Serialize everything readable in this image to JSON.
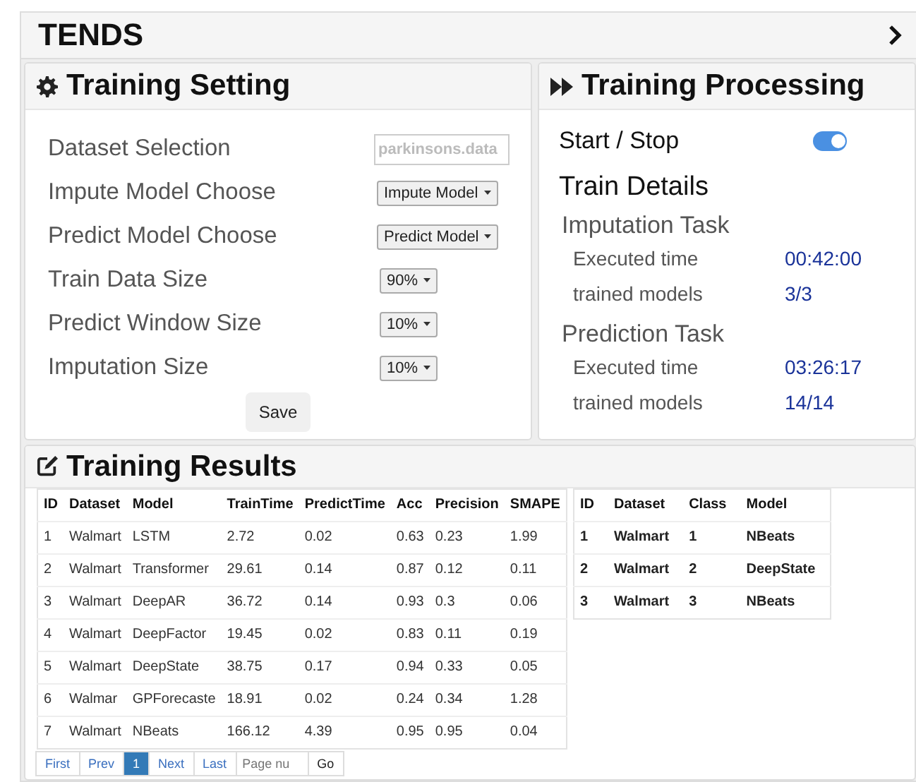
{
  "app": {
    "title": "TENDS"
  },
  "training_setting": {
    "title": "Training Setting",
    "fields": [
      {
        "label": "Dataset Selection",
        "kind": "input",
        "placeholder": "parkinsons.data"
      },
      {
        "label": "Impute Model Choose",
        "kind": "dropdown",
        "value": "Impute Model"
      },
      {
        "label": "Predict Model Choose",
        "kind": "dropdown",
        "value": "Predict Model"
      },
      {
        "label": "Train Data Size",
        "kind": "dropdown",
        "value": "90%"
      },
      {
        "label": "Predict Window Size",
        "kind": "dropdown",
        "value": "10%"
      },
      {
        "label": "Imputation Size",
        "kind": "dropdown",
        "value": "10%"
      }
    ],
    "save": "Save"
  },
  "training_processing": {
    "title": "Training Processing",
    "start_stop": {
      "label": "Start / Stop",
      "on": true
    },
    "details_title": "Train Details",
    "tasks": [
      {
        "title": "Imputation Task",
        "rows": [
          {
            "label": "Executed time",
            "value": "00:42:00"
          },
          {
            "label": "trained models",
            "value": "3/3"
          }
        ]
      },
      {
        "title": "Prediction Task",
        "rows": [
          {
            "label": "Executed time",
            "value": "03:26:17"
          },
          {
            "label": "trained models",
            "value": "14/14"
          }
        ]
      }
    ]
  },
  "training_results": {
    "title": "Training Results",
    "table": {
      "columns": [
        "ID",
        "Dataset",
        "Model",
        "TrainTime",
        "PredictTime",
        "Acc",
        "Precision",
        "SMAPE"
      ],
      "rows": [
        [
          "1",
          "Walmart",
          "LSTM",
          "2.72",
          "0.02",
          "0.63",
          "0.23",
          "1.99"
        ],
        [
          "2",
          "Walmart",
          "Transformer",
          "29.61",
          "0.14",
          "0.87",
          "0.12",
          "0.11"
        ],
        [
          "3",
          "Walmart",
          "DeepAR",
          "36.72",
          "0.14",
          "0.93",
          "0.3",
          "0.06"
        ],
        [
          "4",
          "Walmart",
          "DeepFactor",
          "19.45",
          "0.02",
          "0.83",
          "0.11",
          "0.19"
        ],
        [
          "5",
          "Walmart",
          "DeepState",
          "38.75",
          "0.17",
          "0.94",
          "0.33",
          "0.05"
        ],
        [
          "6",
          "Walmar",
          "GPForecaste",
          "18.91",
          "0.02",
          "0.24",
          "0.34",
          "1.28"
        ],
        [
          "7",
          "Walmart",
          "NBeats",
          "166.12",
          "4.39",
          "0.95",
          "0.95",
          "0.04"
        ]
      ]
    },
    "pager": {
      "buttons": [
        {
          "label": "First",
          "selected": false
        },
        {
          "label": "Prev",
          "selected": false
        },
        {
          "label": "1",
          "selected": true
        },
        {
          "label": "Next",
          "selected": false
        },
        {
          "label": "Last",
          "selected": false
        }
      ],
      "placeholder": "Page nu",
      "go": "Go"
    },
    "best_table": {
      "columns": [
        "ID",
        "Dataset",
        "Class",
        "Model"
      ],
      "rows": [
        [
          "1",
          "Walmart",
          "1",
          "NBeats"
        ],
        [
          "2",
          "Walmart",
          "2",
          "DeepState"
        ],
        [
          "3",
          "Walmart",
          "3",
          "NBeats"
        ]
      ]
    }
  }
}
